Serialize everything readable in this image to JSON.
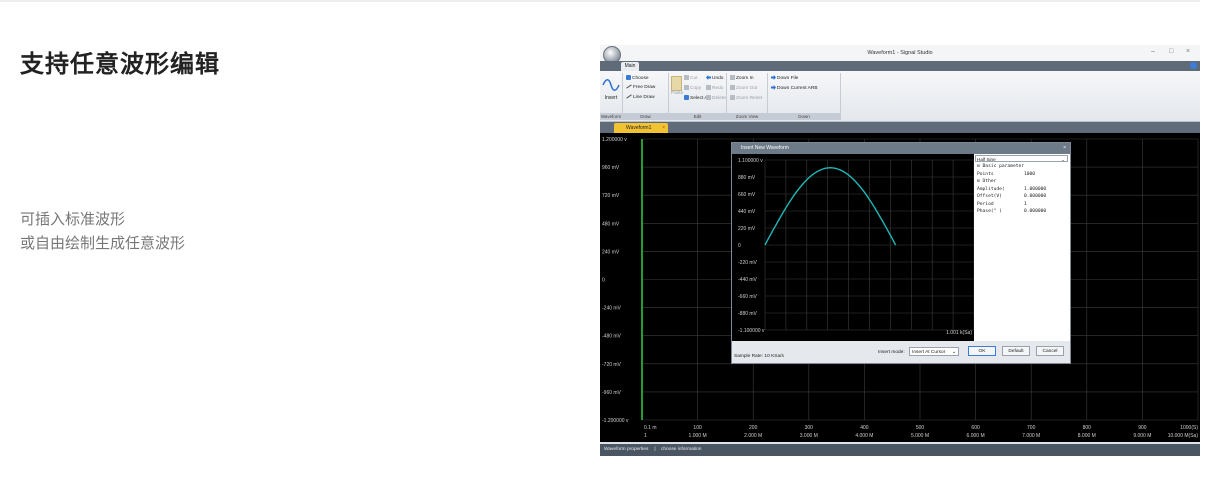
{
  "left": {
    "title": "支持任意波形编辑",
    "desc_line1": "可插入标准波形",
    "desc_line2": "或自由绘制生成任意波形"
  },
  "app": {
    "window_title": "Waveform1 - Signal Studio",
    "win_min": "–",
    "win_max": "□",
    "win_close": "×",
    "tab_main": "Main",
    "groups": {
      "waveform": "Waveform",
      "draw": "Draw",
      "edit": "Edit",
      "zoom": "Zoom View",
      "down": "Down"
    },
    "buttons": {
      "insert": "Insert",
      "choose": "Choose",
      "free_draw": "Free Draw",
      "line_draw": "Line Draw",
      "paste": "Paste",
      "cut": "Cut",
      "copy": "Copy",
      "select_all": "Select All",
      "undo": "Undo",
      "redo": "Redo",
      "delete": "Delete",
      "zoom_in": "Zoom In",
      "zoom_out": "Zoom Out",
      "zoom_reset": "Zoom Reset",
      "down_file": "Down File",
      "down_current_arb": "Down Current ARB"
    },
    "doc_tab": "Waveform1",
    "doc_tab_close": "×",
    "main_plot": {
      "y_labels": [
        "1.200000 v",
        "960    mV",
        "720    mV",
        "480    mV",
        "240    mV",
        "0",
        "-240    mV",
        "-480    mV",
        "-720    mV",
        "-960    mV",
        "-1.200000 v"
      ],
      "x_top": [
        "0.1 m",
        "100",
        "200",
        "300",
        "400",
        "500",
        "600",
        "700",
        "800",
        "900",
        "1000(S)"
      ],
      "x_bottom": [
        "1",
        "1.000 M",
        "2.000 M",
        "3.000 M",
        "4.000 M",
        "5.000 M",
        "6.000 M",
        "7.000 M",
        "8.000 M",
        "9.000 M",
        "10.000 M(Sa)"
      ]
    },
    "status": {
      "waveform_properties": "Waveform properties",
      "choose_information": "choose information"
    },
    "dialog": {
      "title": "Insert New Waveform",
      "close": "×",
      "y_labels": [
        "1.100000 v",
        "880    mV",
        "660    mV",
        "440    mV",
        "220    mV",
        "0",
        "-220    mV",
        "-440    mV",
        "-660    mV",
        "-880    mV",
        "-1.100000 v"
      ],
      "x_end_label": "1.001 k(Sa)",
      "wave_select": "Half Sine",
      "props": [
        {
          "name": "⊟ Basic parameter",
          "value": ""
        },
        {
          "name": "Points",
          "value": "1000"
        },
        {
          "name": "⊟ Other",
          "value": ""
        },
        {
          "name": "Amplitude(",
          "value": "1.000000"
        },
        {
          "name": "Offset(V)",
          "value": "0.000000"
        },
        {
          "name": "Period",
          "value": "1"
        },
        {
          "name": "Phase(° )",
          "value": "0.000000"
        }
      ],
      "sample_rate": "Sample Rate: 10 KSa/s",
      "insert_mode_label": "Insert mode:",
      "insert_mode_value": "Insert At Cursor",
      "ok": "OK",
      "default": "Default",
      "cancel": "Cancel"
    }
  },
  "colors": {
    "wave": "#1fb5b5",
    "grid": "#3c3c3c",
    "axis_green": "#2cc43c",
    "tab_yellow": "#f1c232"
  }
}
